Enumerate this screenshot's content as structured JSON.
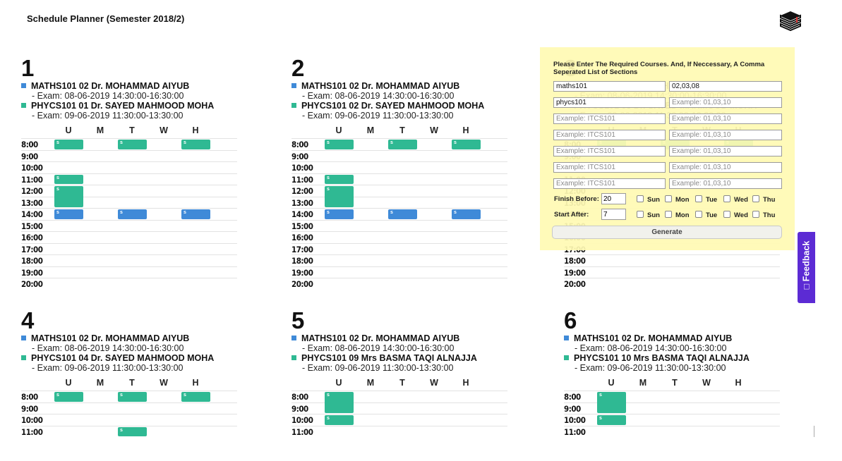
{
  "app": {
    "title": "Schedule Planner (Semester 2018/2)",
    "logo_icon": "stacked-books-icon"
  },
  "colors": {
    "green": "#2fb993",
    "blue": "#3f8ad8",
    "panel": "#fffab4",
    "feedback": "#5c2bd4"
  },
  "days": [
    "U",
    "M",
    "T",
    "W",
    "H"
  ],
  "times": [
    "8:00",
    "9:00",
    "10:00",
    "11:00",
    "12:00",
    "13:00",
    "14:00",
    "15:00",
    "16:00",
    "17:00",
    "18:00",
    "19:00",
    "20:00"
  ],
  "schedules": [
    {
      "number": "1",
      "courses": [
        {
          "label": "MATHS101 02 Dr. MOHAMMAD AIYUB",
          "exam": "- Exam: 08-06-2019 14:30:00-16:30:00",
          "color": "blue"
        },
        {
          "label": "PHYCS101 01 Dr. SAYED MAHMOOD MOHA",
          "exam": "- Exam: 09-06-2019 11:30:00-13:30:00",
          "color": "green"
        }
      ]
    },
    {
      "number": "2",
      "courses": [
        {
          "label": "MATHS101 02 Dr. MOHAMMAD AIYUB",
          "exam": "- Exam: 08-06-2019 14:30:00-16:30:00",
          "color": "blue"
        },
        {
          "label": "PHYCS101 02 Dr. SAYED MAHMOOD MOHA",
          "exam": "- Exam: 09-06-2019 11:30:00-13:30:00",
          "color": "green"
        }
      ]
    },
    {
      "number": "3",
      "courses": [
        {
          "label": "MATHS101 02 Dr. MOHAMMAD AIYUB",
          "exam": "- Exam: 08-06-2019 14:30:00-16:30:00",
          "color": "blue"
        },
        {
          "label": "PHYCS101 03 Dr. SAYED MAHMOOD MOHA",
          "exam": "- Exam: 09-06-2019 11:30:00-13:30:00",
          "color": "green"
        }
      ]
    },
    {
      "number": "4",
      "courses": [
        {
          "label": "MATHS101 02 Dr. MOHAMMAD AIYUB",
          "exam": "- Exam: 08-06-2019 14:30:00-16:30:00",
          "color": "blue"
        },
        {
          "label": "PHYCS101 04 Dr. SAYED MAHMOOD MOHA",
          "exam": "- Exam: 09-06-2019 11:30:00-13:30:00",
          "color": "green"
        }
      ]
    },
    {
      "number": "5",
      "courses": [
        {
          "label": "MATHS101 02 Dr. MOHAMMAD AIYUB",
          "exam": "- Exam: 08-06-2019 14:30:00-16:30:00",
          "color": "blue"
        },
        {
          "label": "PHYCS101 09 Mrs BASMA TAQI ALNAJJA",
          "exam": "- Exam: 09-06-2019 11:30:00-13:30:00",
          "color": "green"
        }
      ]
    },
    {
      "number": "6",
      "courses": [
        {
          "label": "MATHS101 02 Dr. MOHAMMAD AIYUB",
          "exam": "- Exam: 08-06-2019 14:30:00-16:30:00",
          "color": "blue"
        },
        {
          "label": "PHYCS101 10 Mrs BASMA TAQI ALNAJJA",
          "exam": "- Exam: 09-06-2019 11:30:00-13:30:00",
          "color": "green"
        }
      ]
    }
  ],
  "block_tag": "s",
  "form": {
    "instructions": "Please Enter The Required Courses. And, If Neccessary, A Comma Seperated List of Sections",
    "rows": [
      {
        "course": "maths101",
        "sections": "02,03,08",
        "course_placeholder": "Example: ITCS101",
        "section_placeholder": "Example: 01,03,10"
      },
      {
        "course": "phycs101",
        "sections": "",
        "course_placeholder": "Example: ITCS101",
        "section_placeholder": "Example: 01,03,10"
      },
      {
        "course": "",
        "sections": "",
        "course_placeholder": "Example: ITCS101",
        "section_placeholder": "Example: 01,03,10"
      },
      {
        "course": "",
        "sections": "",
        "course_placeholder": "Example: ITCS101",
        "section_placeholder": "Example: 01,03,10"
      },
      {
        "course": "",
        "sections": "",
        "course_placeholder": "Example: ITCS101",
        "section_placeholder": "Example: 01,03,10"
      },
      {
        "course": "",
        "sections": "",
        "course_placeholder": "Example: ITCS101",
        "section_placeholder": "Example: 01,03,10"
      },
      {
        "course": "",
        "sections": "",
        "course_placeholder": "Example: ITCS101",
        "section_placeholder": "Example: 01,03,10"
      }
    ],
    "finish_before_label": "Finish Before:",
    "finish_before_value": "20",
    "start_after_label": "Start After:",
    "start_after_value": "7",
    "day_options": [
      "Sun",
      "Mon",
      "Tue",
      "Wed",
      "Thu"
    ],
    "generate_label": "Generate"
  },
  "feedback": {
    "label": "Feedback",
    "icon": "feedback-icon"
  }
}
